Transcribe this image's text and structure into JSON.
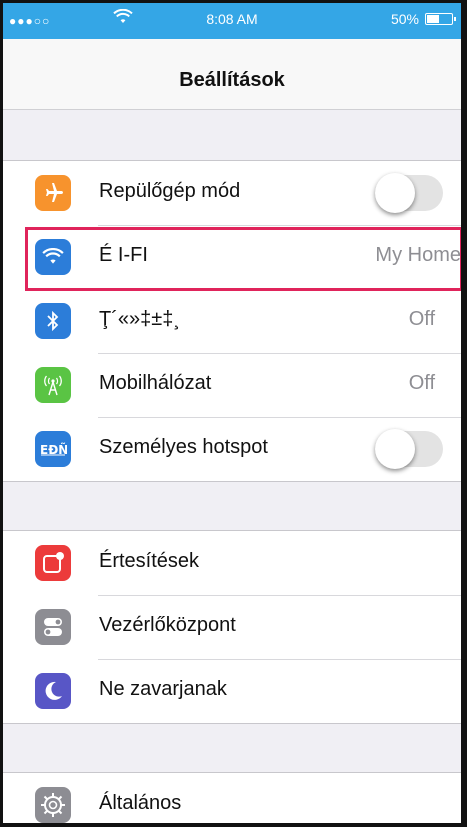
{
  "status_bar": {
    "carrier_signal": "●●●○○",
    "time": "8:08 AM",
    "battery_percent": "50%",
    "battery_level": 0.5
  },
  "nav": {
    "title": "Beállítások"
  },
  "colors": {
    "status_bar": "#34a6e6",
    "airplane": "#f7932d",
    "wifi": "#2c7dd9",
    "bluetooth": "#2c7dd9",
    "cellular": "#5ac444",
    "hotspot": "#2c7dd9",
    "notifications": "#ec3b3b",
    "control_center": "#8d8d93",
    "dnd": "#5856c6",
    "general": "#8d8d93",
    "highlight": "#e0245b"
  },
  "group1": [
    {
      "id": "airplane",
      "icon": "airplane-icon",
      "label": "Repülőgép mód",
      "toggle": false
    },
    {
      "id": "wifi",
      "icon": "wifi-icon",
      "label": "É I-FI",
      "value": "My Home",
      "highlighted": true
    },
    {
      "id": "bluetooth",
      "icon": "bluetooth-icon",
      "label": "Ţ´«»‡±‡¸",
      "value": "Off"
    },
    {
      "id": "cellular",
      "icon": "cellular-antenna-icon",
      "label": "Mobilhálózat",
      "value": "Off"
    },
    {
      "id": "hotspot",
      "icon": "hotspot-icon",
      "label": "Személyes hotspot",
      "toggle": false
    }
  ],
  "group2": [
    {
      "id": "notifications",
      "icon": "notifications-icon",
      "label": "Értesítések"
    },
    {
      "id": "control_center",
      "icon": "control-center-icon",
      "label": "Vezérlőközpont"
    },
    {
      "id": "dnd",
      "icon": "moon-icon",
      "label": "Ne zavarjanak"
    }
  ],
  "group3": [
    {
      "id": "general",
      "icon": "gear-icon",
      "label": "Általános"
    }
  ]
}
